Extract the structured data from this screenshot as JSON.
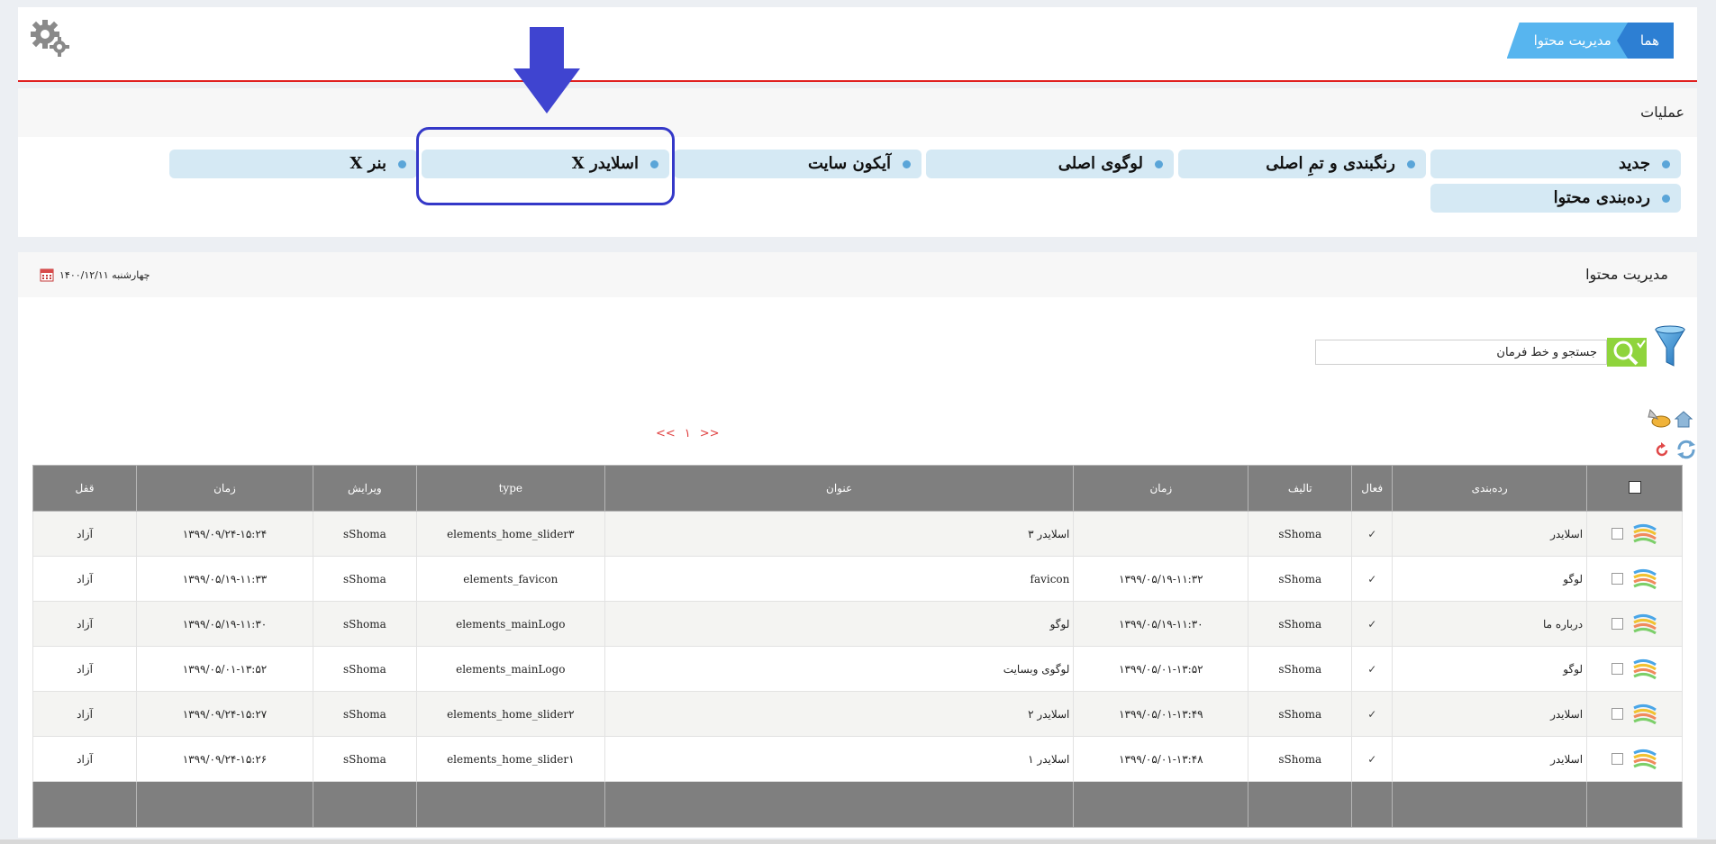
{
  "header": {
    "breadcrumb_home": "هما",
    "breadcrumb_current": "مدیریت محتوا"
  },
  "operations": {
    "title": "عملیات",
    "buttons": [
      {
        "label": "جدید"
      },
      {
        "label": "رنگبندی و تمِ اصلی"
      },
      {
        "label": "لوگوی اصلی"
      },
      {
        "label": "آیکون سایت"
      },
      {
        "label": "اسلایدر X"
      },
      {
        "label": "بنر X"
      },
      {
        "label": "رده‌بندی محتوا"
      }
    ]
  },
  "content": {
    "title": "مدیریت محتوا",
    "date": "چهارشنبه ۱۴۰۰/۱۲/۱۱",
    "search_value": "جستجو و خط فرمان",
    "pager": {
      "prev": "<<",
      "current": "۱",
      "next": ">>"
    }
  },
  "table": {
    "columns": {
      "category": "رده‌بندی",
      "active": "فعال",
      "author": "تالیف",
      "time": "زمان",
      "title": "عنوان",
      "type": "type",
      "edit": "ویرایش",
      "time2": "زمان",
      "lock": "قفل"
    },
    "rows": [
      {
        "category": "اسلایدر",
        "active": "✓",
        "author": "sShoma",
        "time": "",
        "title": "اسلایدر ۳",
        "type": "elements_home_slider۳",
        "edit": "sShoma",
        "time2": "۱۳۹۹/۰۹/۲۴-۱۵:۲۴",
        "lock": "آزاد"
      },
      {
        "category": "لوگو",
        "active": "✓",
        "author": "sShoma",
        "time": "۱۳۹۹/۰۵/۱۹-۱۱:۳۲",
        "title": "favicon",
        "type": "elements_favicon",
        "edit": "sShoma",
        "time2": "۱۳۹۹/۰۵/۱۹-۱۱:۳۳",
        "lock": "آزاد"
      },
      {
        "category": "درباره ما",
        "active": "✓",
        "author": "sShoma",
        "time": "۱۳۹۹/۰۵/۱۹-۱۱:۳۰",
        "title": "لوگو",
        "type": "elements_mainLogo",
        "edit": "sShoma",
        "time2": "۱۳۹۹/۰۵/۱۹-۱۱:۳۰",
        "lock": "آزاد"
      },
      {
        "category": "لوگو",
        "active": "✓",
        "author": "sShoma",
        "time": "۱۳۹۹/۰۵/۰۱-۱۳:۵۲",
        "title": "لوگوی وبسایت",
        "type": "elements_mainLogo",
        "edit": "sShoma",
        "time2": "۱۳۹۹/۰۵/۰۱-۱۳:۵۲",
        "lock": "آزاد"
      },
      {
        "category": "اسلایدر",
        "active": "✓",
        "author": "sShoma",
        "time": "۱۳۹۹/۰۵/۰۱-۱۳:۴۹",
        "title": "اسلایدر ۲",
        "type": "elements_home_slider۲",
        "edit": "sShoma",
        "time2": "۱۳۹۹/۰۹/۲۴-۱۵:۲۷",
        "lock": "آزاد"
      },
      {
        "category": "اسلایدر",
        "active": "✓",
        "author": "sShoma",
        "time": "۱۳۹۹/۰۵/۰۱-۱۳:۴۸",
        "title": "اسلایدر ۱",
        "type": "elements_home_slider۱",
        "edit": "sShoma",
        "time2": "۱۳۹۹/۰۹/۲۴-۱۵:۲۶",
        "lock": "آزاد"
      }
    ]
  },
  "colors": {
    "accent_blue": "#2d7fd3",
    "breadcrumb_light": "#57b5ef",
    "header_rule": "#e02020",
    "button_bg": "#d5e9f4",
    "annotation": "#3438c8",
    "table_header": "#7f7f7f"
  },
  "icons": {
    "settings": "gear-icon",
    "calendar": "calendar-icon",
    "filter": "filter-funnel-icon",
    "search": "search-magnifier-icon",
    "row": "color-palette-icon"
  }
}
